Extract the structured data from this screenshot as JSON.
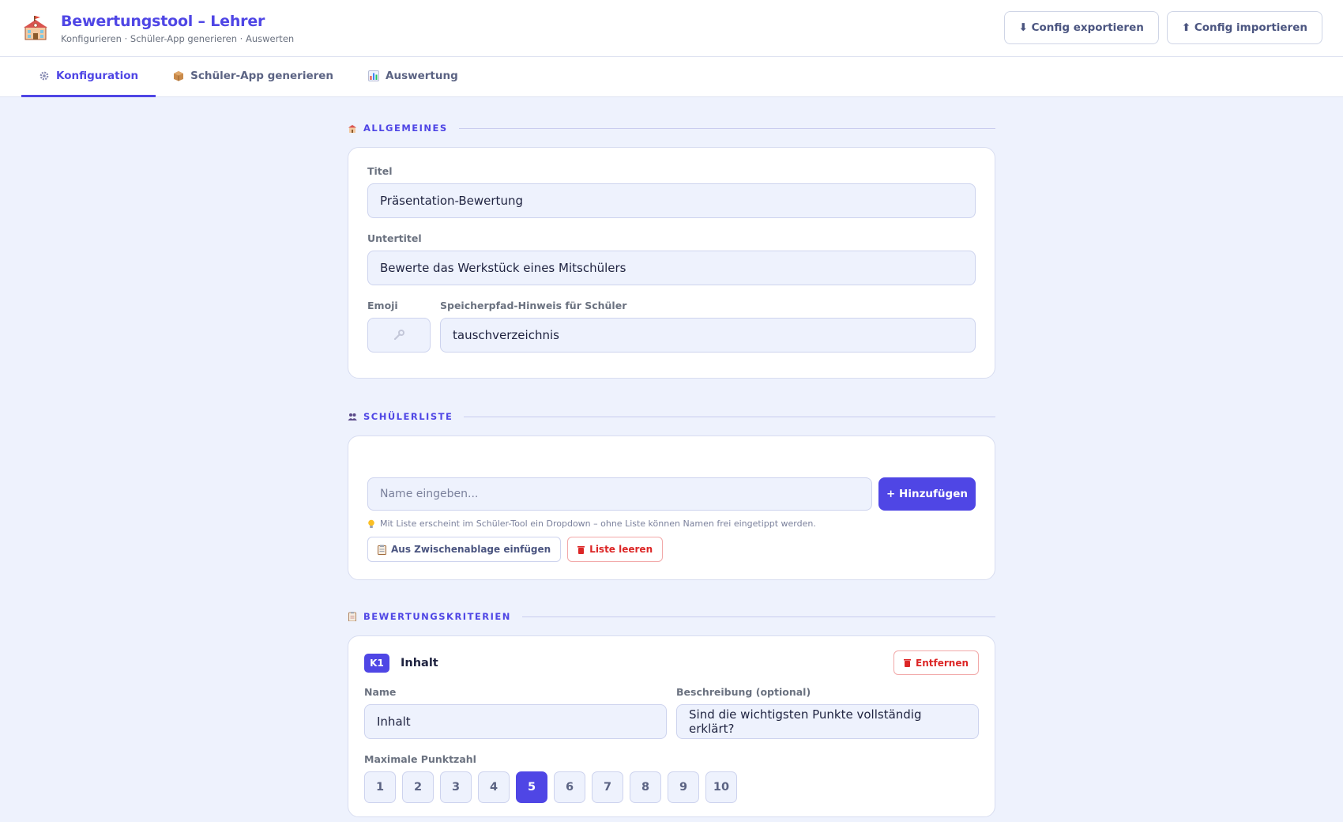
{
  "header": {
    "title": "Bewertungstool – Lehrer",
    "subtitle": "Konfigurieren · Schüler-App generieren · Auswerten",
    "export_label": "⬇ Config exportieren",
    "import_label": "⬆ Config importieren"
  },
  "tabs": [
    {
      "label": "Konfiguration",
      "icon": "gear-icon",
      "active": true
    },
    {
      "label": "Schüler-App generieren",
      "icon": "package-icon",
      "active": false
    },
    {
      "label": "Auswertung",
      "icon": "bar-chart-icon",
      "active": false
    }
  ],
  "general": {
    "heading": "ALLGEMEINES",
    "title_label": "Titel",
    "title_value": "Präsentation-Bewertung",
    "subtitle_label": "Untertitel",
    "subtitle_value": "Bewerte das Werkstück eines Mitschülers",
    "emoji_label": "Emoji",
    "path_label": "Speicherpfad-Hinweis für Schüler",
    "path_value": "tauschverzeichnis"
  },
  "students": {
    "heading": "SCHÜLERLISTE",
    "name_placeholder": "Name eingeben...",
    "add_label": "+ Hinzufügen",
    "hint": "Mit Liste erscheint im Schüler-Tool ein Dropdown – ohne Liste können Namen frei eingetippt werden.",
    "paste_label": "Aus Zwischenablage einfügen",
    "clear_label": "Liste leeren"
  },
  "criteria": {
    "heading": "BEWERTUNGSKRITERIEN",
    "items": [
      {
        "badge": "K1",
        "title": "Inhalt",
        "remove_label": "Entfernen",
        "name_label": "Name",
        "name_value": "Inhalt",
        "desc_label": "Beschreibung (optional)",
        "desc_value": "Sind die wichtigsten Punkte vollständig erklärt?",
        "max_label": "Maximale Punktzahl",
        "options": [
          "1",
          "2",
          "3",
          "4",
          "5",
          "6",
          "7",
          "8",
          "9",
          "10"
        ],
        "selected": "5"
      }
    ]
  },
  "colors": {
    "accent": "#4f46e5",
    "danger": "#dc2626",
    "background": "#eef2fd"
  }
}
